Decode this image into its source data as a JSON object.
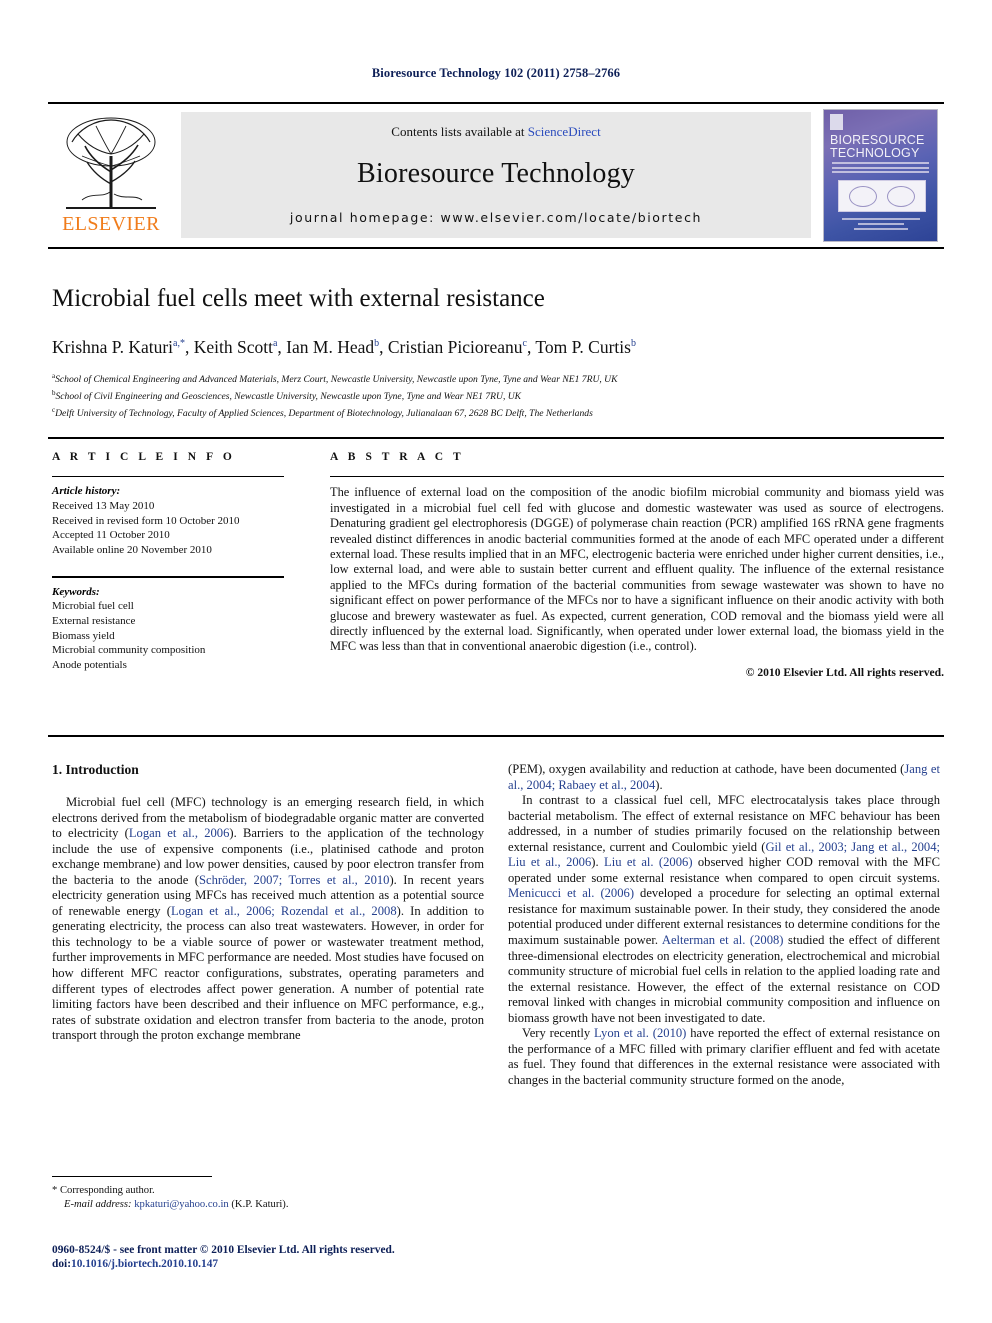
{
  "running_head": "Bioresource Technology 102 (2011) 2758–2766",
  "masthead": {
    "contents_prefix": "Contents lists available at",
    "sciencedirect": "ScienceDirect",
    "journal_title": "Bioresource Technology",
    "homepage": "journal homepage: www.elsevier.com/locate/biortech",
    "publisher_wordmark": "ELSEVIER",
    "cover_title_line1": "BIORESOURCE",
    "cover_title_line2": "TECHNOLOGY",
    "logo_icon": "elsevier-tree-logo",
    "cover_icon": "journal-cover-thumbnail"
  },
  "article": {
    "title": "Microbial fuel cells meet with external resistance",
    "authors": [
      {
        "name": "Krishna P. Katuri",
        "sup": "a,",
        "star": "*"
      },
      {
        "name": "Keith Scott",
        "sup": "a"
      },
      {
        "name": "Ian M. Head",
        "sup": "b"
      },
      {
        "name": "Cristian Picioreanu",
        "sup": "c"
      },
      {
        "name": "Tom P. Curtis",
        "sup": "b"
      }
    ],
    "affiliations": [
      {
        "mark": "a",
        "text": "School of Chemical Engineering and Advanced Materials, Merz Court, Newcastle University, Newcastle upon Tyne, Tyne and Wear NE1 7RU, UK"
      },
      {
        "mark": "b",
        "text": "School of Civil Engineering and Geosciences, Newcastle University, Newcastle upon Tyne, Tyne and Wear NE1 7RU, UK"
      },
      {
        "mark": "c",
        "text": "Delft University of Technology, Faculty of Applied Sciences, Department of Biotechnology, Julianalaan 67, 2628 BC Delft, The Netherlands"
      }
    ]
  },
  "article_info": {
    "heading": "A R T I C L E   I N F O",
    "history_label": "Article history:",
    "history": [
      "Received 13 May 2010",
      "Received in revised form 10 October 2010",
      "Accepted 11 October 2010",
      "Available online 20 November 2010"
    ],
    "keywords_label": "Keywords:",
    "keywords": [
      "Microbial fuel cell",
      "External resistance",
      "Biomass yield",
      "Microbial community composition",
      "Anode potentials"
    ]
  },
  "abstract": {
    "heading": "A B S T R A C T",
    "text": "The influence of external load on the composition of the anodic biofilm microbial community and biomass yield was investigated in a microbial fuel cell fed with glucose and domestic wastewater was used as source of electrogens. Denaturing gradient gel electrophoresis (DGGE) of polymerase chain reaction (PCR) amplified 16S rRNA gene fragments revealed distinct differences in anodic bacterial communities formed at the anode of each MFC operated under a different external load. These results implied that in an MFC, electrogenic bacteria were enriched under higher current densities, i.e., low external load, and were able to sustain better current and effluent quality. The influence of the external resistance applied to the MFCs during formation of the bacterial communities from sewage wastewater was shown to have no significant effect on power performance of the MFCs nor to have a significant influence on their anodic activity with both glucose and brewery wastewater as fuel. As expected, current generation, COD removal and the biomass yield were all directly influenced by the external load. Significantly, when operated under lower external load, the biomass yield in the MFC was less than that in conventional anaerobic digestion (i.e., control).",
    "copyright": "© 2010 Elsevier Ltd. All rights reserved."
  },
  "body": {
    "section_heading": "1. Introduction",
    "left_paragraphs": [
      {
        "parts": [
          {
            "t": "Microbial fuel cell (MFC) technology is an emerging research field, in which electrons derived from the metabolism of biodegradable organic matter are converted to electricity (",
            "k": "plain"
          },
          {
            "t": "Logan et al., 2006",
            "k": "ref"
          },
          {
            "t": "). Barriers to the application of the technology include the use of expensive components (i.e., platinised cathode and proton exchange membrane) and low power densities, caused by poor electron transfer from the bacteria to the anode (",
            "k": "plain"
          },
          {
            "t": "Schröder, 2007; Torres et al., 2010",
            "k": "ref"
          },
          {
            "t": "). In recent years electricity generation using MFCs has received much attention as a potential source of renewable energy (",
            "k": "plain"
          },
          {
            "t": "Logan et al., 2006; Rozendal et al., 2008",
            "k": "ref"
          },
          {
            "t": "). In addition to generating electricity, the process can also treat wastewaters. However, in order for this technology to be a viable source of power or wastewater treatment method, further improvements in MFC performance are needed. Most studies have focused on how different MFC reactor configurations, substrates, operating parameters and different types of electrodes affect power generation. A number of potential rate limiting factors have been described and their influence on MFC performance, e.g., rates of substrate oxidation and electron transfer from bacteria to the anode, proton transport through the proton exchange membrane",
            "k": "plain"
          }
        ]
      }
    ],
    "right_paragraphs": [
      {
        "indent": false,
        "parts": [
          {
            "t": "(PEM), oxygen availability and reduction at cathode, have been documented (",
            "k": "plain"
          },
          {
            "t": "Jang et al., 2004; Rabaey et al., 2004",
            "k": "ref"
          },
          {
            "t": ").",
            "k": "plain"
          }
        ]
      },
      {
        "indent": true,
        "parts": [
          {
            "t": "In contrast to a classical fuel cell, MFC electrocatalysis takes place through bacterial metabolism. The effect of external resistance on MFC behaviour has been addressed, in a number of studies primarily focused on the relationship between external resistance, current and Coulombic yield (",
            "k": "plain"
          },
          {
            "t": "Gil et al., 2003; Jang et al., 2004; Liu et al., 2006",
            "k": "ref"
          },
          {
            "t": "). ",
            "k": "plain"
          },
          {
            "t": "Liu et al. (2006)",
            "k": "ref"
          },
          {
            "t": " observed higher COD removal with the MFC operated under some external resistance when compared to open circuit systems. ",
            "k": "plain"
          },
          {
            "t": "Menicucci et al. (2006)",
            "k": "ref"
          },
          {
            "t": " developed a procedure for selecting an optimal external resistance for maximum sustainable power. In their study, they considered the anode potential produced under different external resistances to determine conditions for the maximum sustainable power. ",
            "k": "plain"
          },
          {
            "t": "Aelterman et al. (2008)",
            "k": "ref"
          },
          {
            "t": " studied the effect of different three-dimensional electrodes on electricity generation, electrochemical and microbial community structure of microbial fuel cells in relation to the applied loading rate and the external resistance. However, the effect of the external resistance on COD removal linked with changes in microbial community composition and influence on biomass growth have not been investigated to date.",
            "k": "plain"
          }
        ]
      },
      {
        "indent": true,
        "parts": [
          {
            "t": "Very recently ",
            "k": "plain"
          },
          {
            "t": "Lyon et al. (2010)",
            "k": "ref"
          },
          {
            "t": " have reported the effect of external resistance on the performance of a MFC filled with primary clarifier effluent and fed with acetate as fuel. They found that differences in the external resistance were associated with changes in the bacterial community structure formed on the anode,",
            "k": "plain"
          }
        ]
      }
    ]
  },
  "footnotes": {
    "corresponding_marker": "*",
    "corresponding": "Corresponding author.",
    "email_label": "E-mail address:",
    "email": "kpkaturi@yahoo.co.in",
    "email_owner": "(K.P. Katuri)."
  },
  "imprint": {
    "line1": "0960-8524/$ - see front matter © 2010 Elsevier Ltd. All rights reserved.",
    "doi_label": "doi:",
    "doi_value": "10.1016/j.biortech.2010.10.147"
  },
  "colors": {
    "link_blue": "#26418f",
    "header_navy": "#0d1f57",
    "elsevier_orange": "#f07c1b",
    "masthead_grey": "#e8e8e8"
  }
}
